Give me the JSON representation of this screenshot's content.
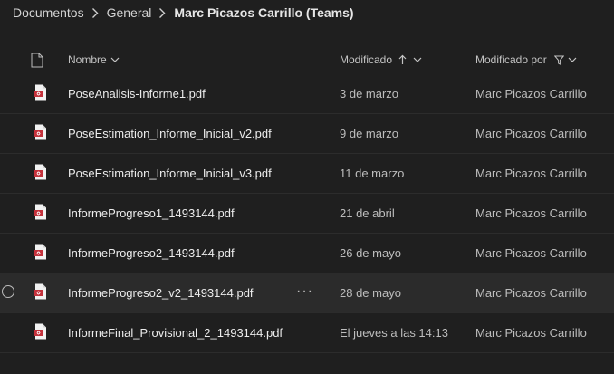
{
  "breadcrumb": {
    "items": [
      "Documentos",
      "General",
      "Marc Picazos Carrillo (Teams)"
    ]
  },
  "header": {
    "name_label": "Nombre",
    "modified_label": "Modificado",
    "modified_by_label": "Modificado por"
  },
  "files": [
    {
      "name": "PoseAnalisis-Informe1.pdf",
      "modified": "3 de marzo",
      "modified_by": "Marc Picazos Carrillo"
    },
    {
      "name": "PoseEstimation_Informe_Inicial_v2.pdf",
      "modified": "9 de marzo",
      "modified_by": "Marc Picazos Carrillo"
    },
    {
      "name": "PoseEstimation_Informe_Inicial_v3.pdf",
      "modified": "11 de marzo",
      "modified_by": "Marc Picazos Carrillo"
    },
    {
      "name": "InformeProgreso1_1493144.pdf",
      "modified": "21 de abril",
      "modified_by": "Marc Picazos Carrillo"
    },
    {
      "name": "InformeProgreso2_1493144.pdf",
      "modified": "26 de mayo",
      "modified_by": "Marc Picazos Carrillo"
    },
    {
      "name": "InformeProgreso2_v2_1493144.pdf",
      "modified": "28 de mayo",
      "modified_by": "Marc Picazos Carrillo",
      "more": "···"
    },
    {
      "name": "InformeFinal_Provisional_2_1493144.pdf",
      "modified": "El jueves a las 14:13",
      "modified_by": "Marc Picazos Carrillo"
    }
  ],
  "colors": {
    "background": "#1f1f1f",
    "hover_row": "#2b2b2b",
    "pdf_red": "#c4313b"
  },
  "icons": [
    "file-type-icon",
    "chevron-right-icon",
    "chevron-down-icon",
    "sort-ascending-icon",
    "filter-icon",
    "pdf-file-icon",
    "row-select-circle",
    "more-options-icon"
  ]
}
